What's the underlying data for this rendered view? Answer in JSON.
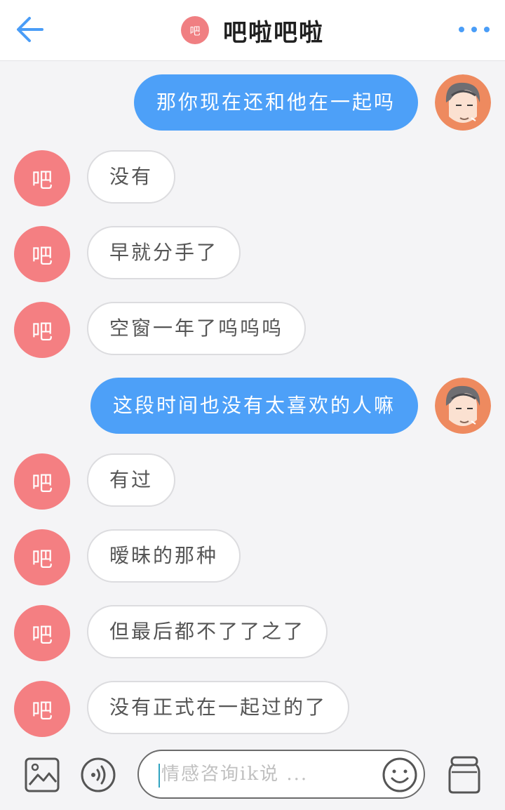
{
  "header": {
    "title": "吧啦吧啦",
    "badge_text": "吧"
  },
  "avatar_text": "吧",
  "messages": [
    {
      "from": "me",
      "text": "那你现在还和他在一起吗"
    },
    {
      "from": "other",
      "text": "没有"
    },
    {
      "from": "other",
      "text": "早就分手了"
    },
    {
      "from": "other",
      "text": "空窗一年了呜呜呜"
    },
    {
      "from": "me",
      "text": "这段时间也没有太喜欢的人嘛"
    },
    {
      "from": "other",
      "text": "有过"
    },
    {
      "from": "other",
      "text": "暧昧的那种"
    },
    {
      "from": "other",
      "text": "但最后都不了了之了"
    },
    {
      "from": "other",
      "text": "没有正式在一起过的了"
    }
  ],
  "input": {
    "placeholder": "情感咨询ik说 ..."
  },
  "icons": {
    "back": "arrow-left-icon",
    "more": "more-dots-icon",
    "image": "image-icon",
    "voice": "voice-icon",
    "emoji": "smile-icon",
    "jar": "jar-icon"
  },
  "colors": {
    "accent": "#4da0f8",
    "avatar": "#f47f82"
  }
}
